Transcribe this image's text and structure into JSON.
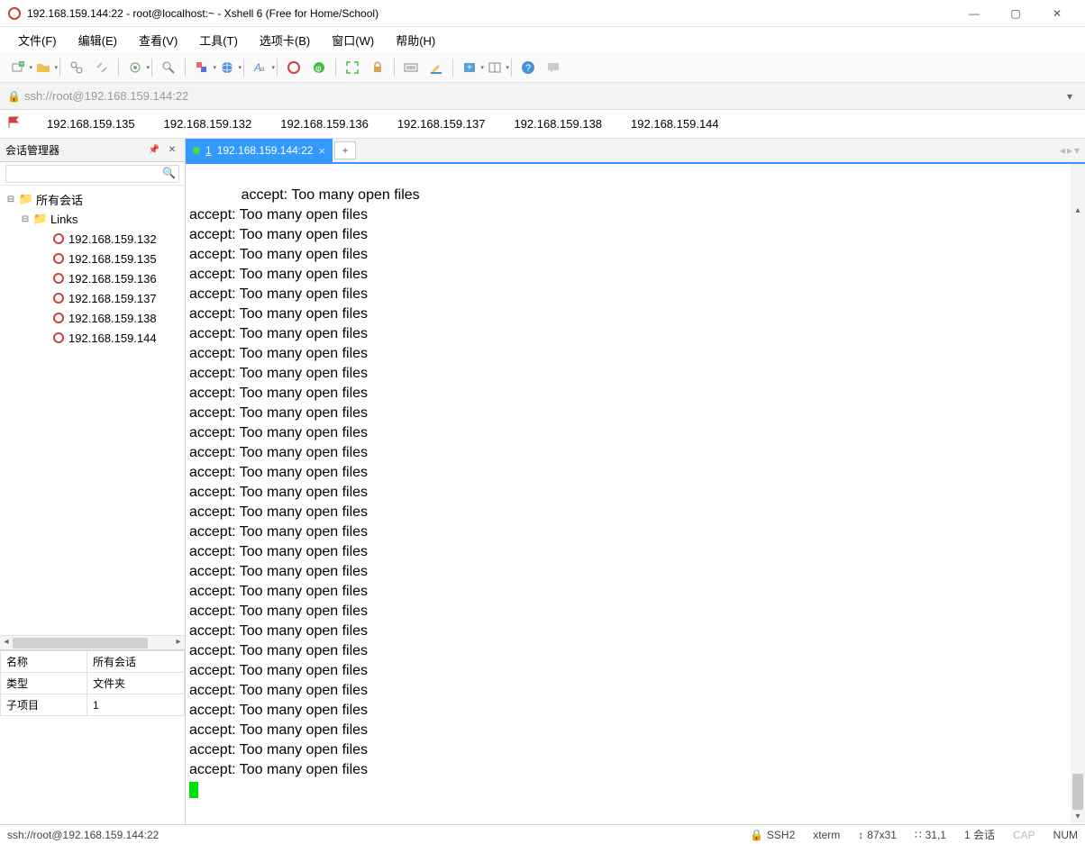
{
  "window": {
    "title": "192.168.159.144:22 - root@localhost:~ - Xshell 6 (Free for Home/School)"
  },
  "menus": [
    "文件(F)",
    "编辑(E)",
    "查看(V)",
    "工具(T)",
    "选项卡(B)",
    "窗口(W)",
    "帮助(H)"
  ],
  "address": {
    "url": "ssh://root@192.168.159.144:22"
  },
  "quicklinks": [
    "192.168.159.135",
    "192.168.159.132",
    "192.168.159.136",
    "192.168.159.137",
    "192.168.159.138",
    "192.168.159.144"
  ],
  "sidebar": {
    "title": "会话管理器",
    "search_placeholder": "",
    "tree": {
      "root": {
        "label": "所有会话"
      },
      "links": {
        "label": "Links"
      },
      "sessions": [
        "192.168.159.132",
        "192.168.159.135",
        "192.168.159.136",
        "192.168.159.137",
        "192.168.159.138",
        "192.168.159.144"
      ]
    },
    "props": [
      {
        "k": "名称",
        "v": "所有会话"
      },
      {
        "k": "类型",
        "v": "文件夹"
      },
      {
        "k": "子项目",
        "v": "1"
      }
    ]
  },
  "tabs": {
    "active": {
      "num": "1",
      "label": "192.168.159.144:22"
    }
  },
  "terminal": {
    "line": "accept: Too many open files",
    "repeat": 30
  },
  "status": {
    "conn": "ssh://root@192.168.159.144:22",
    "proto": "SSH2",
    "term": "xterm",
    "size": "87x31",
    "cursor": "31,1",
    "sessions": "1 会话",
    "cap": "CAP",
    "num": "NUM",
    "resize_label": "↕ "
  }
}
